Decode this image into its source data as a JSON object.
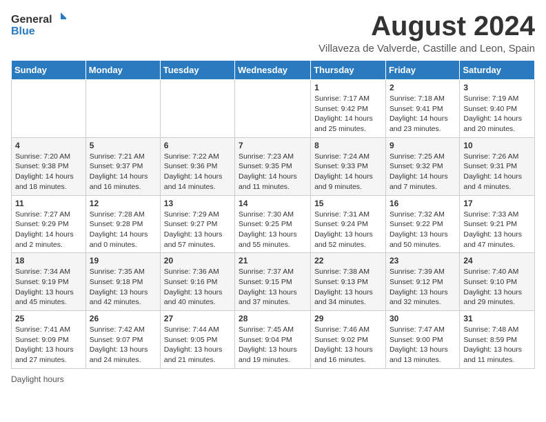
{
  "header": {
    "logo_general": "General",
    "logo_blue": "Blue",
    "month_title": "August 2024",
    "location": "Villaveza de Valverde, Castille and Leon, Spain"
  },
  "weekdays": [
    "Sunday",
    "Monday",
    "Tuesday",
    "Wednesday",
    "Thursday",
    "Friday",
    "Saturday"
  ],
  "weeks": [
    [
      {
        "day": "",
        "sunrise": "",
        "sunset": "",
        "daylight": ""
      },
      {
        "day": "",
        "sunrise": "",
        "sunset": "",
        "daylight": ""
      },
      {
        "day": "",
        "sunrise": "",
        "sunset": "",
        "daylight": ""
      },
      {
        "day": "",
        "sunrise": "",
        "sunset": "",
        "daylight": ""
      },
      {
        "day": "1",
        "sunrise": "Sunrise: 7:17 AM",
        "sunset": "Sunset: 9:42 PM",
        "daylight": "Daylight: 14 hours and 25 minutes."
      },
      {
        "day": "2",
        "sunrise": "Sunrise: 7:18 AM",
        "sunset": "Sunset: 9:41 PM",
        "daylight": "Daylight: 14 hours and 23 minutes."
      },
      {
        "day": "3",
        "sunrise": "Sunrise: 7:19 AM",
        "sunset": "Sunset: 9:40 PM",
        "daylight": "Daylight: 14 hours and 20 minutes."
      }
    ],
    [
      {
        "day": "4",
        "sunrise": "Sunrise: 7:20 AM",
        "sunset": "Sunset: 9:38 PM",
        "daylight": "Daylight: 14 hours and 18 minutes."
      },
      {
        "day": "5",
        "sunrise": "Sunrise: 7:21 AM",
        "sunset": "Sunset: 9:37 PM",
        "daylight": "Daylight: 14 hours and 16 minutes."
      },
      {
        "day": "6",
        "sunrise": "Sunrise: 7:22 AM",
        "sunset": "Sunset: 9:36 PM",
        "daylight": "Daylight: 14 hours and 14 minutes."
      },
      {
        "day": "7",
        "sunrise": "Sunrise: 7:23 AM",
        "sunset": "Sunset: 9:35 PM",
        "daylight": "Daylight: 14 hours and 11 minutes."
      },
      {
        "day": "8",
        "sunrise": "Sunrise: 7:24 AM",
        "sunset": "Sunset: 9:33 PM",
        "daylight": "Daylight: 14 hours and 9 minutes."
      },
      {
        "day": "9",
        "sunrise": "Sunrise: 7:25 AM",
        "sunset": "Sunset: 9:32 PM",
        "daylight": "Daylight: 14 hours and 7 minutes."
      },
      {
        "day": "10",
        "sunrise": "Sunrise: 7:26 AM",
        "sunset": "Sunset: 9:31 PM",
        "daylight": "Daylight: 14 hours and 4 minutes."
      }
    ],
    [
      {
        "day": "11",
        "sunrise": "Sunrise: 7:27 AM",
        "sunset": "Sunset: 9:29 PM",
        "daylight": "Daylight: 14 hours and 2 minutes."
      },
      {
        "day": "12",
        "sunrise": "Sunrise: 7:28 AM",
        "sunset": "Sunset: 9:28 PM",
        "daylight": "Daylight: 14 hours and 0 minutes."
      },
      {
        "day": "13",
        "sunrise": "Sunrise: 7:29 AM",
        "sunset": "Sunset: 9:27 PM",
        "daylight": "Daylight: 13 hours and 57 minutes."
      },
      {
        "day": "14",
        "sunrise": "Sunrise: 7:30 AM",
        "sunset": "Sunset: 9:25 PM",
        "daylight": "Daylight: 13 hours and 55 minutes."
      },
      {
        "day": "15",
        "sunrise": "Sunrise: 7:31 AM",
        "sunset": "Sunset: 9:24 PM",
        "daylight": "Daylight: 13 hours and 52 minutes."
      },
      {
        "day": "16",
        "sunrise": "Sunrise: 7:32 AM",
        "sunset": "Sunset: 9:22 PM",
        "daylight": "Daylight: 13 hours and 50 minutes."
      },
      {
        "day": "17",
        "sunrise": "Sunrise: 7:33 AM",
        "sunset": "Sunset: 9:21 PM",
        "daylight": "Daylight: 13 hours and 47 minutes."
      }
    ],
    [
      {
        "day": "18",
        "sunrise": "Sunrise: 7:34 AM",
        "sunset": "Sunset: 9:19 PM",
        "daylight": "Daylight: 13 hours and 45 minutes."
      },
      {
        "day": "19",
        "sunrise": "Sunrise: 7:35 AM",
        "sunset": "Sunset: 9:18 PM",
        "daylight": "Daylight: 13 hours and 42 minutes."
      },
      {
        "day": "20",
        "sunrise": "Sunrise: 7:36 AM",
        "sunset": "Sunset: 9:16 PM",
        "daylight": "Daylight: 13 hours and 40 minutes."
      },
      {
        "day": "21",
        "sunrise": "Sunrise: 7:37 AM",
        "sunset": "Sunset: 9:15 PM",
        "daylight": "Daylight: 13 hours and 37 minutes."
      },
      {
        "day": "22",
        "sunrise": "Sunrise: 7:38 AM",
        "sunset": "Sunset: 9:13 PM",
        "daylight": "Daylight: 13 hours and 34 minutes."
      },
      {
        "day": "23",
        "sunrise": "Sunrise: 7:39 AM",
        "sunset": "Sunset: 9:12 PM",
        "daylight": "Daylight: 13 hours and 32 minutes."
      },
      {
        "day": "24",
        "sunrise": "Sunrise: 7:40 AM",
        "sunset": "Sunset: 9:10 PM",
        "daylight": "Daylight: 13 hours and 29 minutes."
      }
    ],
    [
      {
        "day": "25",
        "sunrise": "Sunrise: 7:41 AM",
        "sunset": "Sunset: 9:09 PM",
        "daylight": "Daylight: 13 hours and 27 minutes."
      },
      {
        "day": "26",
        "sunrise": "Sunrise: 7:42 AM",
        "sunset": "Sunset: 9:07 PM",
        "daylight": "Daylight: 13 hours and 24 minutes."
      },
      {
        "day": "27",
        "sunrise": "Sunrise: 7:44 AM",
        "sunset": "Sunset: 9:05 PM",
        "daylight": "Daylight: 13 hours and 21 minutes."
      },
      {
        "day": "28",
        "sunrise": "Sunrise: 7:45 AM",
        "sunset": "Sunset: 9:04 PM",
        "daylight": "Daylight: 13 hours and 19 minutes."
      },
      {
        "day": "29",
        "sunrise": "Sunrise: 7:46 AM",
        "sunset": "Sunset: 9:02 PM",
        "daylight": "Daylight: 13 hours and 16 minutes."
      },
      {
        "day": "30",
        "sunrise": "Sunrise: 7:47 AM",
        "sunset": "Sunset: 9:00 PM",
        "daylight": "Daylight: 13 hours and 13 minutes."
      },
      {
        "day": "31",
        "sunrise": "Sunrise: 7:48 AM",
        "sunset": "Sunset: 8:59 PM",
        "daylight": "Daylight: 13 hours and 11 minutes."
      }
    ]
  ],
  "footer": {
    "daylight_note": "Daylight hours"
  }
}
